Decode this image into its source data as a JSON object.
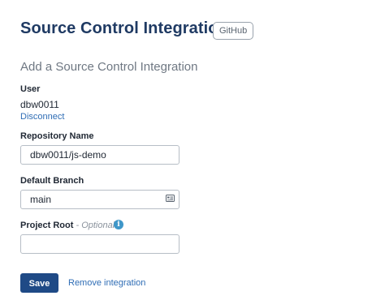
{
  "header": {
    "title": "Source Control Integration",
    "badge": "GitHub"
  },
  "form": {
    "subtitle": "Add a Source Control Integration",
    "user": {
      "label": "User",
      "value": "dbw0011",
      "disconnect_label": "Disconnect"
    },
    "repository": {
      "label": "Repository Name",
      "value": "dbw0011/js-demo"
    },
    "branch": {
      "label": "Default Branch",
      "value": "main",
      "icon": "list-card-icon"
    },
    "project_root": {
      "label": "Project Root",
      "optional_label": "- Optional",
      "value": "",
      "info_icon": "info-icon"
    },
    "actions": {
      "save_label": "Save",
      "remove_label": "Remove integration"
    }
  },
  "colors": {
    "title": "#1f3a63",
    "link": "#2f6db5",
    "primary_button": "#1f4a86",
    "info_icon": "#3f97c9"
  }
}
